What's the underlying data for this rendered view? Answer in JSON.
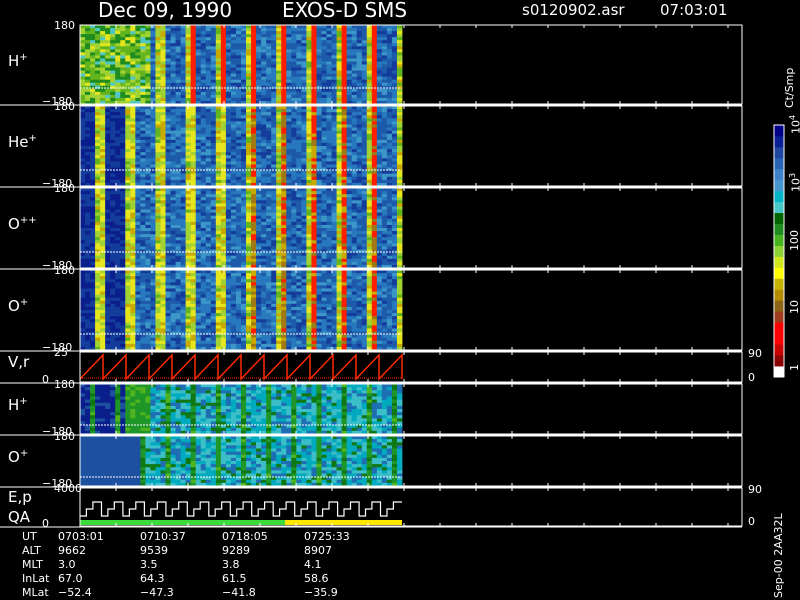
{
  "header": {
    "date": "Dec 09, 1990",
    "instrument": "EXOS-D SMS",
    "file": "s0120902.asr",
    "time": "07:03:01"
  },
  "panels": [
    {
      "label": "H",
      "sup": "+",
      "ymax": "180",
      "ymin": "−180"
    },
    {
      "label": "He",
      "sup": "+",
      "ymax": "180",
      "ymin": "−180"
    },
    {
      "label": "O",
      "sup": "++",
      "ymax": "180",
      "ymin": "−180"
    },
    {
      "label": "O",
      "sup": "+",
      "ymax": "180",
      "ymin": "−180"
    },
    {
      "label": "V,r",
      "sup": "",
      "ymax": "25",
      "ymin": "0",
      "right_top": "90",
      "right_bottom": "0"
    },
    {
      "label": "H",
      "sup": "+",
      "ymax": "180",
      "ymin": "−180"
    },
    {
      "label": "O",
      "sup": "+",
      "ymax": "180",
      "ymin": "−180"
    },
    {
      "label": "E,p",
      "label2": "QA",
      "ymax": "4000",
      "ymin": "0",
      "right_top": "90",
      "right_bottom": "0"
    }
  ],
  "colorbar": {
    "title": "Ct/Smp",
    "ticks": [
      "1",
      "10",
      "100",
      "10",
      "10"
    ],
    "tick_exponents": [
      "",
      "",
      "",
      "3",
      "4"
    ],
    "colors": [
      "#00008b",
      "#0a1e96",
      "#1e46a0",
      "#2864b4",
      "#3c82c8",
      "#4696d2",
      "#00b4c8",
      "#46c8c8",
      "#006400",
      "#1e8c1e",
      "#46b41e",
      "#8cd232",
      "#d2e61e",
      "#ffff00",
      "#c8b400",
      "#b48c00",
      "#8c6414",
      "#a03c1e",
      "#ff0000",
      "#ff0000",
      "#c80000",
      "#8b0000",
      "#ffffff"
    ]
  },
  "ephemeris": {
    "rows": [
      {
        "name": "UT",
        "values": [
          "0703:01",
          "0710:37",
          "0718:05",
          "0725:33"
        ]
      },
      {
        "name": "ALT",
        "values": [
          "9662",
          "9539",
          "9289",
          "8907"
        ]
      },
      {
        "name": "MLT",
        "values": [
          "3.0",
          "3.5",
          "3.8",
          "4.1"
        ]
      },
      {
        "name": "InLat",
        "values": [
          "67.0",
          "64.3",
          "61.5",
          "58.6"
        ]
      },
      {
        "name": "MLat",
        "values": [
          "−52.4",
          "−47.3",
          "−41.8",
          "−35.9"
        ]
      }
    ]
  },
  "footer_note": "Sep-00 2AA32L",
  "colors": {
    "background": "#000000",
    "axis": "#ffffff",
    "vr_trace": "#ff2a00",
    "qa_green": "#3cdc3c",
    "qa_yellow": "#ffe600"
  },
  "chart_data": {
    "type": "heatmap",
    "title": "Dec 09, 1990   EXOS-D SMS",
    "x_ticks_ut": [
      "0703:01",
      "0710:37",
      "0718:05",
      "0725:33"
    ],
    "y_range_pitch_deg": [
      -180,
      180
    ],
    "colorbar_range": [
      1,
      10000
    ],
    "colorbar_scale": "log",
    "colorbar_unit": "Ct/Smp",
    "vr_range": [
      0,
      25
    ],
    "ep_range": [
      0,
      4000
    ]
  }
}
